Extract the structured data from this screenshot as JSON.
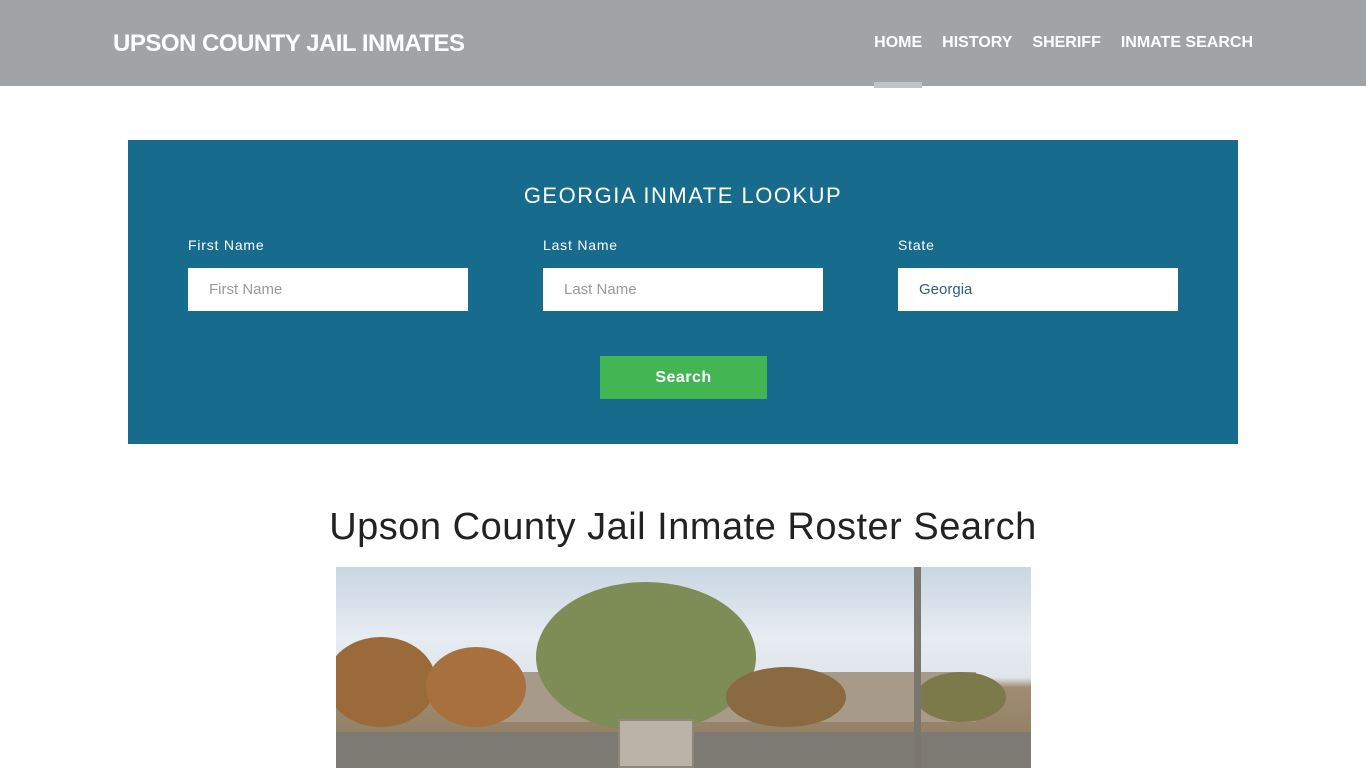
{
  "nav": {
    "brand": "UPSON COUNTY JAIL INMATES",
    "items": [
      {
        "label": "HOME",
        "active": true
      },
      {
        "label": "HISTORY"
      },
      {
        "label": "SHERIFF"
      },
      {
        "label": "INMATE SEARCH"
      }
    ]
  },
  "lookup": {
    "title": "GEORGIA INMATE LOOKUP",
    "first_name": {
      "label": "First Name",
      "placeholder": "First Name"
    },
    "last_name": {
      "label": "Last Name",
      "placeholder": "Last Name"
    },
    "state": {
      "label": "State",
      "value": "Georgia"
    },
    "search_label": "Search"
  },
  "main": {
    "title": "Upson County Jail Inmate Roster Search"
  },
  "colors": {
    "nav": "#a0a4a7",
    "panel": "#176b8d",
    "button": "#43b653"
  }
}
